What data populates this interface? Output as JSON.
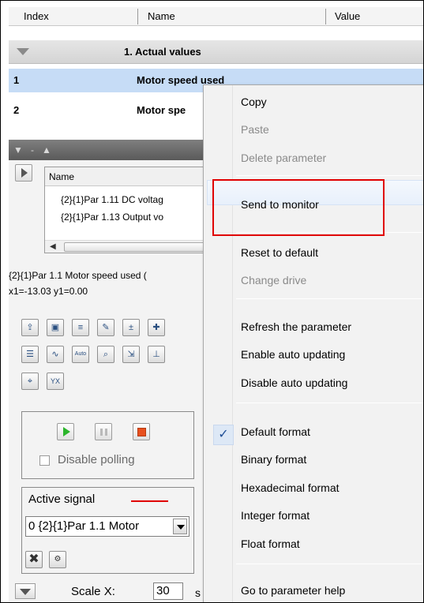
{
  "grid": {
    "columns": [
      "Index",
      "Name",
      "Value"
    ],
    "group_title": "1. Actual values",
    "rows": [
      {
        "index": "1",
        "name": "Motor speed used",
        "selected": true
      },
      {
        "index": "2",
        "name": "Motor spe"
      }
    ]
  },
  "monitor": {
    "list_header": "Name",
    "signals": [
      "{2}{1}Par 1.11 DC voltag",
      "{2}{1}Par 1.13 Output vo"
    ],
    "signal_info": "{2}{1}Par 1.1 Motor speed used (",
    "cursor_info": "x1=-13.03 y1=0.00",
    "toolbar": {
      "auto_label": "Auto",
      "xy_label": "YX"
    },
    "disable_polling_label": "Disable polling",
    "disable_polling_checked": false,
    "active_signal_label": "Active signal",
    "active_signal_color": "#e00000",
    "active_signal_value": "0 {2}{1}Par 1.1 Motor",
    "scale_label": "Scale X:",
    "scale_value": "30",
    "scale_unit": "s"
  },
  "context_menu": {
    "items": [
      {
        "label": "Copy",
        "enabled": true
      },
      {
        "label": "Paste",
        "enabled": false
      },
      {
        "label": "Delete parameter",
        "enabled": false
      },
      {
        "label": "Send to monitor",
        "enabled": true,
        "hovered": true
      },
      {
        "label": "Reset to default",
        "enabled": true
      },
      {
        "label": "Change drive",
        "enabled": false
      },
      {
        "label": "Refresh the parameter",
        "enabled": true
      },
      {
        "label": "Enable auto updating",
        "enabled": true
      },
      {
        "label": "Disable auto updating",
        "enabled": true
      },
      {
        "label": "Default format",
        "enabled": true,
        "checked": true
      },
      {
        "label": "Binary format",
        "enabled": true
      },
      {
        "label": "Hexadecimal format",
        "enabled": true
      },
      {
        "label": "Integer format",
        "enabled": true
      },
      {
        "label": "Float format",
        "enabled": true
      },
      {
        "label": "Go to parameter help",
        "enabled": true
      }
    ],
    "checkmark": "✓"
  },
  "colors": {
    "selected_row": "#c6dcf6",
    "highlight_box": "#e00000",
    "play_green": "#2bb52b",
    "stop_red": "#e8501e"
  }
}
